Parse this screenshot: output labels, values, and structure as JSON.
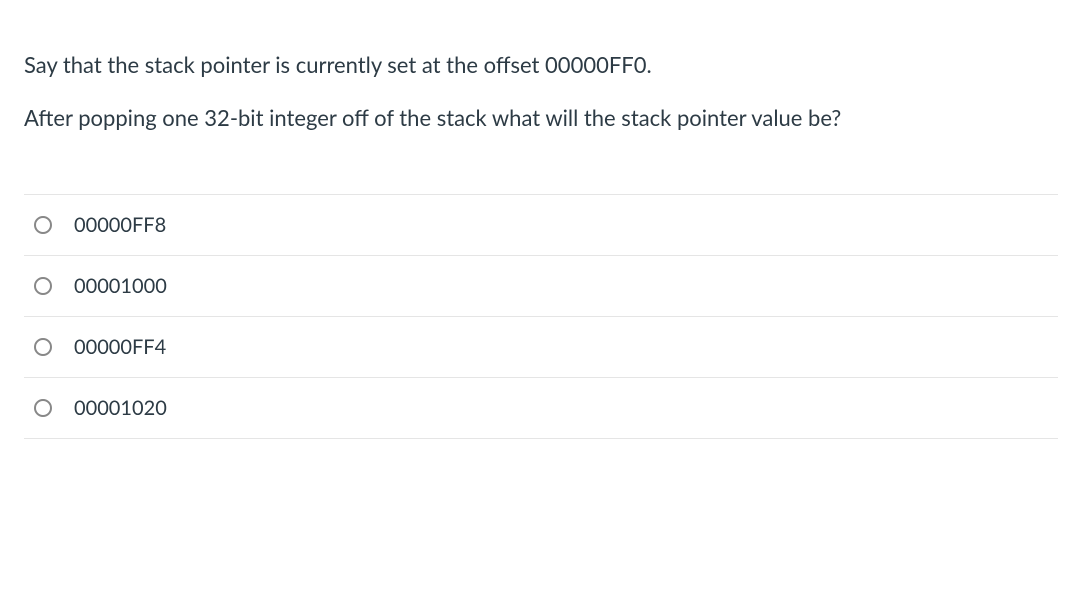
{
  "question": {
    "paragraph1": "Say that the stack pointer is currently set at the offset 00000FF0.",
    "paragraph2": "After popping one 32-bit integer off of the stack what will the stack pointer value be?"
  },
  "options": [
    {
      "label": "00000FF8"
    },
    {
      "label": "00001000"
    },
    {
      "label": "00000FF4"
    },
    {
      "label": "00001020"
    }
  ]
}
